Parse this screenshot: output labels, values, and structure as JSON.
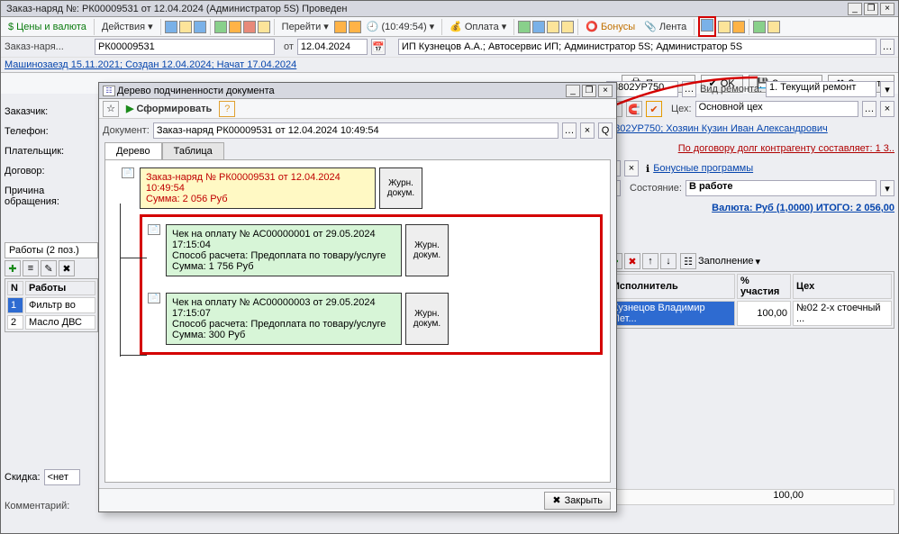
{
  "window": {
    "title": "Заказ-наряд №: РК00009531 от 12.04.2024 (Администратор 5S) Проведен",
    "minimize_icon": "_",
    "restore_icon": "❐",
    "close_icon": "×"
  },
  "toolbar": {
    "prices": "Цены и валюта",
    "actions": "Действия",
    "goto": "Перейти",
    "time": "(10:49:54)",
    "pay": "Оплата",
    "bonuses": "Бонусы",
    "lenta": "Лента"
  },
  "header": {
    "doc_label": "Заказ-наря...",
    "doc_no": "РК00009531",
    "date_label": "от",
    "date": "12.04.2024",
    "org": "ИП Кузнецов А.А.; Автосервис ИП; Администратор 5S; Администратор 5S",
    "history": "Машинозаезд 15.11.2021; Создан 12.04.2024; Начат 17.04.2024"
  },
  "left_labels": {
    "customer": "Заказчик:",
    "phone": "Телефон:",
    "payer": "Плательщик:",
    "contract": "Договор:",
    "reason": "Причина обращения:",
    "discount": "Скидка:",
    "discount_val": "<нет",
    "comment": "Комментарий:"
  },
  "works": {
    "tab": "Работы (2 поз.)",
    "col_n": "N",
    "col_work": "Работы",
    "rows": [
      {
        "n": "1",
        "name": "Фильтр во"
      },
      {
        "n": "2",
        "name": "Масло ДВС"
      }
    ]
  },
  "right": {
    "car_plate": "М802УР750",
    "repair_type_label": "Вид ремонта:",
    "repair_type": "1. Текущий ремонт",
    "shop_label": "Цех:",
    "shop": "Основной цех",
    "owner": "М802УР750; Хозяин Кузин Иван Александрович",
    "debt": "По договору долг контрагенту составляет: 1 3..",
    "bonuses_link": "Бонусные программы",
    "status_label": "Состояние:",
    "status": "В работе",
    "totals": "Валюта: Руб (1,0000) ИТОГО: 2 056,00"
  },
  "performers": {
    "fill_btn": "Заполнение",
    "col1": "Исполнитель",
    "col2": "% участия",
    "col3": "Цех",
    "row": {
      "name": "Кузнецов Владимир Пет...",
      "pct": "100,00",
      "shop": "№02  2-х стоечный ..."
    },
    "total_pct": "100,00"
  },
  "footer": {
    "print": "Печать",
    "ok": "OK",
    "save": "Записать",
    "close": "Закрыть"
  },
  "modal": {
    "title": "Дерево подчиненности документа",
    "form_btn": "Сформировать",
    "doc_label": "Документ:",
    "doc_value": "Заказ-наряд РК00009531 от 12.04.2024 10:49:54",
    "tab1": "Дерево",
    "tab2": "Таблица",
    "close_btn": "Закрыть",
    "root": {
      "l1": "Заказ-наряд № РК00009531 от 12.04.2024 10:49:54",
      "l2": "Сумма: 2 056 Руб"
    },
    "journal_btn": "Журн. докум.",
    "check1": {
      "l1": "Чек на оплату № АС00000001 от 29.05.2024 17:15:04",
      "l2": "Способ расчета: Предоплата по товару/услуге",
      "l3": "Сумма: 1 756 Руб"
    },
    "check2": {
      "l1": "Чек на оплату № АС00000003 от 29.05.2024 17:15:07",
      "l2": "Способ расчета: Предоплата по товару/услуге",
      "l3": "Сумма: 300 Руб"
    }
  },
  "chart_data": {
    "type": "table",
    "title": "Дерево подчиненности документа",
    "documents": [
      {
        "type": "Заказ-наряд",
        "number": "РК00009531",
        "date": "12.04.2024 10:49:54",
        "sum": 2056,
        "currency": "Руб"
      },
      {
        "type": "Чек на оплату",
        "number": "АС00000001",
        "date": "29.05.2024 17:15:04",
        "method": "Предоплата по товару/услуге",
        "sum": 1756,
        "currency": "Руб",
        "parent": "РК00009531"
      },
      {
        "type": "Чек на оплату",
        "number": "АС00000003",
        "date": "29.05.2024 17:15:07",
        "method": "Предоплата по товару/услуге",
        "sum": 300,
        "currency": "Руб",
        "parent": "РК00009531"
      }
    ]
  }
}
